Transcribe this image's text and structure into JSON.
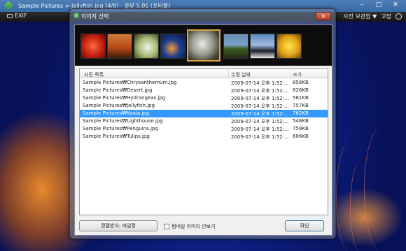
{
  "window": {
    "title": "Sample Pictures > Jellyfish.jpg [4/8] - 꿀뷰 5.01 (포터블)",
    "controls": [
      "–",
      "□",
      "✕"
    ]
  },
  "toolbar": {
    "exif_label": "EXIF",
    "favorites_label": "사진 보관함 ▼",
    "pin_label": "고정"
  },
  "dialog": {
    "title": "이미지 선택",
    "close_label": "✕",
    "thumbnails": [
      {
        "name": "Chrysanthemum"
      },
      {
        "name": "Desert"
      },
      {
        "name": "Hydrangeas"
      },
      {
        "name": "Jellyfish"
      },
      {
        "name": "Koala",
        "selected": true
      },
      {
        "name": "Lighthouse"
      },
      {
        "name": "Penguins"
      },
      {
        "name": "Tulips"
      }
    ],
    "columns": {
      "name": "사진 목록",
      "date": "수정 날짜",
      "size": "크기"
    },
    "files": [
      {
        "name": "Sample Pictures₩Chrysanthemum.jpg",
        "date": "2009-07-14 오후 1:52:...",
        "size": "858KB"
      },
      {
        "name": "Sample Pictures₩Desert.jpg",
        "date": "2009-07-14 오후 1:52:...",
        "size": "826KB"
      },
      {
        "name": "Sample Pictures₩Hydrangeas.jpg",
        "date": "2009-07-14 오후 1:52:...",
        "size": "581KB"
      },
      {
        "name": "Sample Pictures₩Jellyfish.jpg",
        "date": "2009-07-14 오후 1:52:...",
        "size": "757KB"
      },
      {
        "name": "Sample Pictures₩Koala.jpg",
        "date": "2009-07-14 오후 1:52:...",
        "size": "762KB",
        "selected": true
      },
      {
        "name": "Sample Pictures₩Lighthouse.jpg",
        "date": "2009-07-14 오후 1:52:...",
        "size": "548KB"
      },
      {
        "name": "Sample Pictures₩Penguins.jpg",
        "date": "2009-07-14 오후 1:52:...",
        "size": "759KB"
      },
      {
        "name": "Sample Pictures₩Tulips.jpg",
        "date": "2009-07-14 오후 1:52:...",
        "size": "606KB"
      }
    ],
    "sort_label": "정렬방식: 파일명",
    "thumb_toggle_label": "썸네일 이미지 안보기",
    "ok_label": "확인"
  },
  "colors": {
    "selection": "#3399ff",
    "thumb_highlight": "#d9a441",
    "close_button": "#c4402a"
  }
}
